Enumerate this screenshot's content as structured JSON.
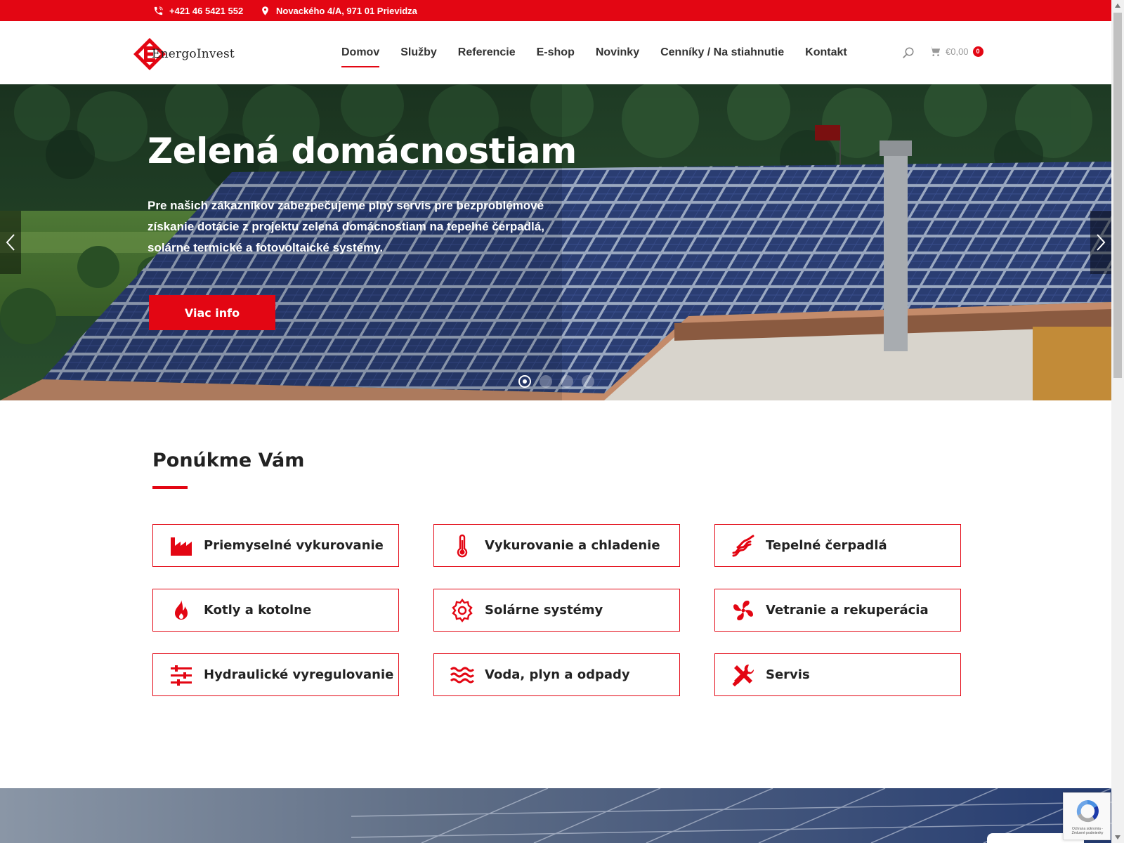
{
  "topbar": {
    "phone": "+421 46 5421 552",
    "address": "Novackého 4/A, 971 01 Prievidza",
    "bg_color": "#e30613"
  },
  "header": {
    "logo_text": "EnergoInvest",
    "nav": [
      {
        "label": "Domov",
        "active": true
      },
      {
        "label": "Služby"
      },
      {
        "label": "Referencie"
      },
      {
        "label": "E-shop"
      },
      {
        "label": "Novinky"
      },
      {
        "label": "Cenníky / Na stiahnutie"
      },
      {
        "label": "Kontakt"
      }
    ],
    "cart_total": "€0,00",
    "cart_count": "0",
    "icons": [
      "search-icon",
      "cart-icon"
    ]
  },
  "hero": {
    "title": "Zelená domácnostiam",
    "text": "Pre našich zákazníkov zabezpečujeme plný servis pre bezproblémové získanie dotácie z projektu zelená domácnostiam na tepelné čerpadlá, solárne termické a fotovoltaické systémy.",
    "button_label": "Viac info",
    "slides": 4,
    "active_slide": 1
  },
  "services": {
    "title": "Ponúkme Vám",
    "items": [
      {
        "label": "Priemyselné vykurovanie",
        "icon": "factory-icon"
      },
      {
        "label": "Vykurovanie a chladenie",
        "icon": "thermometer-icon"
      },
      {
        "label": "Tepelné čerpadlá",
        "icon": "heat-pump-icon"
      },
      {
        "label": "Kotly a kotolne",
        "icon": "flame-icon"
      },
      {
        "label": "Solárne systémy",
        "icon": "gear-icon"
      },
      {
        "label": "Vetranie a rekuperácia",
        "icon": "fan-icon"
      },
      {
        "label": "Hydraulické vyregulovanie",
        "icon": "sliders-icon"
      },
      {
        "label": "Voda, plyn a odpady",
        "icon": "waves-icon"
      },
      {
        "label": "Servis",
        "icon": "tools-icon"
      }
    ]
  },
  "recaptcha_text": "Ochrana súkromia - Zmluvné podmienky",
  "accent_color": "#e30613"
}
